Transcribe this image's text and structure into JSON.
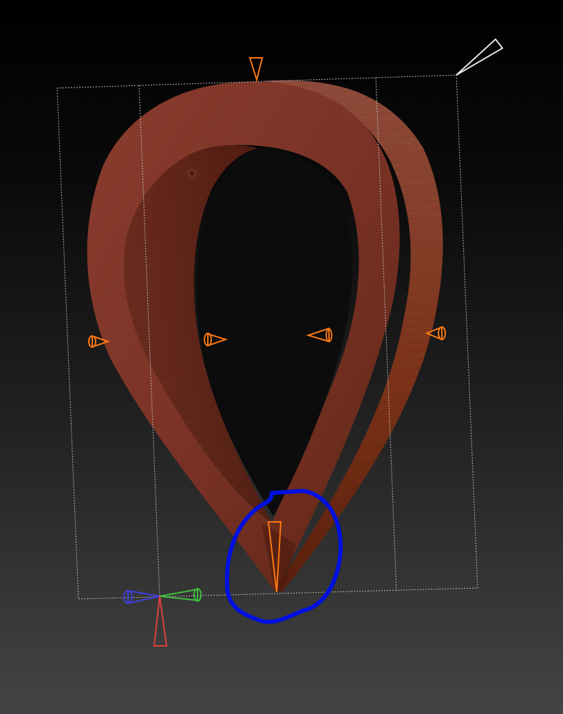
{
  "viewport": {
    "background_top": "#000000",
    "background_bottom": "#444444"
  },
  "model": {
    "name": "teardrop-ring",
    "color_front": "#7a3326",
    "color_side": "#8c3a22",
    "color_shadow": "#4a1a10"
  },
  "gizmo": {
    "handle_color": "#ff7a12",
    "bbox_color": "#bfbfbf",
    "corner_handle_color": "#e6e6e6",
    "axis_x_color": "#e04040",
    "axis_y_color": "#40c040",
    "axis_z_color": "#4040e0"
  },
  "annotation": {
    "circle_color": "#0010e0"
  },
  "icons": {
    "pivot": "gear-icon"
  }
}
